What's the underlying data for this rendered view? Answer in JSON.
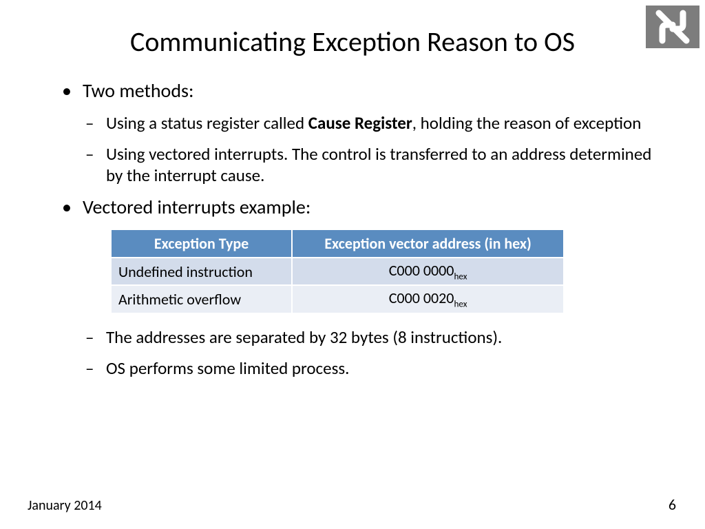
{
  "title": "Communicating Exception Reason to OS",
  "bullets": {
    "b1": "Two methods:",
    "b1a_pre": "Using a status register called ",
    "b1a_bold": "Cause Register",
    "b1a_post": ", holding the reason of exception",
    "b1b": "Using vectored interrupts. The control is transferred to an address determined by the interrupt cause.",
    "b2": "Vectored interrupts example:",
    "b3a": "The addresses are separated by 32 bytes (8 instructions).",
    "b3b": "OS performs some limited process."
  },
  "chart_data": {
    "type": "table",
    "headers": [
      "Exception Type",
      "Exception vector address (in hex)"
    ],
    "rows": [
      {
        "type": "Undefined instruction",
        "addr": "C000 0000",
        "sub": "hex"
      },
      {
        "type": "Arithmetic overflow",
        "addr": "C000 0020",
        "sub": "hex"
      }
    ]
  },
  "footer": {
    "date": "January  2014",
    "page": "6"
  }
}
